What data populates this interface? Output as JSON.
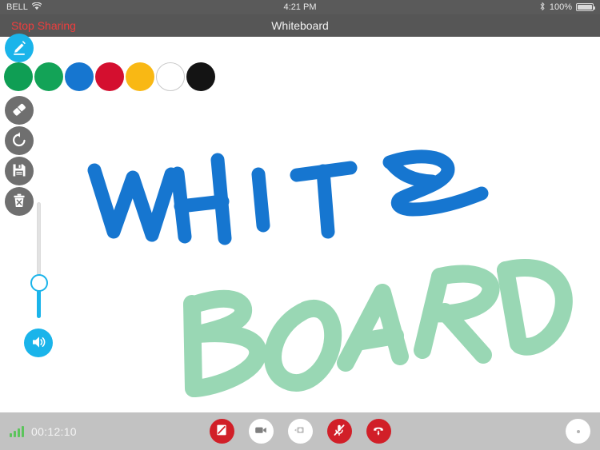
{
  "status_bar": {
    "carrier": "BELL",
    "wifi_icon": "wifi-icon",
    "time": "4:21 PM",
    "bluetooth_icon": "bluetooth-icon",
    "battery_percent": "100%",
    "battery_icon": "battery-full-icon"
  },
  "nav_bar": {
    "stop_sharing_label": "Stop Sharing",
    "stop_sharing_color": "#ef3d3d",
    "title": "Whiteboard",
    "background": "#565656"
  },
  "tools": {
    "items": [
      {
        "name": "pen-tool",
        "icon": "pencil-icon",
        "label": "Pen",
        "active": true,
        "background": "#1ab4ea"
      },
      {
        "name": "eraser-tool",
        "icon": "eraser-icon",
        "label": "Eraser",
        "active": false,
        "background": "#6f6f6f"
      },
      {
        "name": "undo-tool",
        "icon": "undo-icon",
        "label": "Undo",
        "active": false,
        "background": "#6f6f6f"
      },
      {
        "name": "save-tool",
        "icon": "save-icon",
        "label": "Save",
        "active": false,
        "background": "#6f6f6f"
      },
      {
        "name": "clear-tool",
        "icon": "trash-x-icon",
        "label": "Clear",
        "active": false,
        "background": "#6f6f6f"
      }
    ]
  },
  "palette": {
    "colors": [
      {
        "name": "color-green",
        "hex": "#0f9e54",
        "selected": false,
        "outlined": false
      },
      {
        "name": "color-green-light",
        "hex": "#13a357",
        "selected": false,
        "outlined": false
      },
      {
        "name": "color-blue",
        "hex": "#1676d0",
        "selected": true,
        "outlined": false
      },
      {
        "name": "color-red",
        "hex": "#d40f2f",
        "selected": false,
        "outlined": false
      },
      {
        "name": "color-amber",
        "hex": "#f9b814",
        "selected": false,
        "outlined": false
      },
      {
        "name": "color-white",
        "hex": "#ffffff",
        "selected": false,
        "outlined": true
      },
      {
        "name": "color-black",
        "hex": "#141414",
        "selected": false,
        "outlined": false
      }
    ]
  },
  "brush_slider": {
    "name": "brush-size-slider",
    "orientation": "vertical",
    "value_percent": 31,
    "track_color": "#e2e2e2",
    "fill_color": "#1ab4ea"
  },
  "speaker": {
    "name": "speaker-button",
    "icon": "speaker-on-icon",
    "background": "#1ab4ea"
  },
  "canvas": {
    "background": "#ffffff",
    "strokes": [
      {
        "text": "WHITE",
        "color": "#1676d0",
        "opacity": 1
      },
      {
        "text": "BOARD",
        "color": "#8fd3ac",
        "opacity": 0.85
      }
    ]
  },
  "call_bar": {
    "background": "#c2c2c2",
    "signal_icon": "signal-bars-icon",
    "signal_color": "#5cc45c",
    "timer": "00:12:10",
    "buttons": [
      {
        "name": "share-screen-off-button",
        "icon": "screen-share-off-icon",
        "style": "red"
      },
      {
        "name": "camera-button",
        "icon": "video-camera-icon",
        "style": "white"
      },
      {
        "name": "switch-camera-button",
        "icon": "camera-flip-icon",
        "style": "white"
      },
      {
        "name": "microphone-muted-button",
        "icon": "mic-muted-icon",
        "style": "red"
      },
      {
        "name": "end-call-button",
        "icon": "end-call-icon",
        "style": "red"
      }
    ],
    "more_button": {
      "name": "more-options-button",
      "icon": "ellipsis-icon"
    }
  }
}
